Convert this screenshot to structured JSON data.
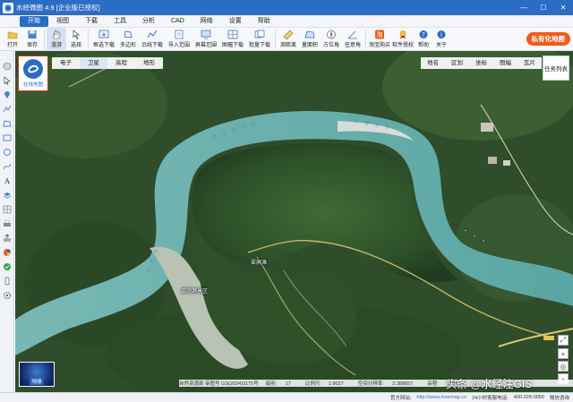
{
  "titlebar": {
    "title": "水经微图 4.9 [企业版已授权]",
    "controls": [
      "—",
      "☐",
      "✕"
    ]
  },
  "menu": [
    {
      "label": "开始",
      "active": true
    },
    {
      "label": "视图"
    },
    {
      "label": "下载"
    },
    {
      "label": "工具"
    },
    {
      "label": "分析"
    },
    {
      "label": "CAD"
    },
    {
      "label": "网络"
    },
    {
      "label": "设置"
    },
    {
      "label": "帮助"
    }
  ],
  "toolbar": [
    {
      "label": "打开",
      "icon": "folder-icon"
    },
    {
      "label": "保存",
      "icon": "save-icon"
    },
    {
      "label": "漫游",
      "icon": "hand-icon",
      "selected": true
    },
    {
      "label": "选择",
      "icon": "cursor-icon"
    },
    {
      "label": "框选下载",
      "icon": "box-download-icon"
    },
    {
      "label": "多边形",
      "icon": "polygon-icon"
    },
    {
      "label": "沿线下载",
      "icon": "line-download-icon"
    },
    {
      "label": "导入范围",
      "icon": "import-icon"
    },
    {
      "label": "屏幕范围",
      "icon": "screen-icon"
    },
    {
      "label": "图幅下载",
      "icon": "sheet-icon"
    },
    {
      "label": "批量下载",
      "icon": "batch-icon"
    },
    {
      "label": "测距离",
      "icon": "ruler-icon"
    },
    {
      "label": "量面积",
      "icon": "area-icon"
    },
    {
      "label": "方位角",
      "icon": "compass-icon"
    },
    {
      "label": "任意角",
      "icon": "angle-icon"
    },
    {
      "label": "淘宝购买",
      "icon": "taobao-icon"
    },
    {
      "label": "软件授权",
      "icon": "license-icon"
    },
    {
      "label": "帮助",
      "icon": "help-icon"
    },
    {
      "label": "关于",
      "icon": "info-icon"
    }
  ],
  "private_map_button": "私有化地图",
  "logo_label": "在线地图",
  "layer_tabs": [
    {
      "label": "电子"
    },
    {
      "label": "卫星",
      "active": true
    },
    {
      "label": "高程"
    },
    {
      "label": "地形"
    }
  ],
  "right_tabs": [
    "地名",
    "区划",
    "坐标",
    "图幅",
    "瓦片"
  ],
  "task_list": "任务列表",
  "map_labels": {
    "scenic": "翠屏滩",
    "area": "莱茵港景区"
  },
  "globe_label": "地球",
  "coord_bar": {
    "source": "自然资源部 审图号 GS(2024)3175号",
    "level_label": "级别:",
    "level": "17",
    "scale_label": "比例尺:",
    "scale": "1:9027",
    "resolution_label": "空间分辨率:",
    "resolution": "2.388657",
    "elevation_label": "高程:",
    "elevation": "1184.32"
  },
  "status_bar": {
    "site_label": "官方网站:",
    "site": "http://www.rivermap.cn",
    "hotline_label": "24小时客服电话:",
    "hotline": "400-028-0050",
    "wechat": "微信咨询"
  },
  "watermark": "头条 @水经注GIS",
  "colors": {
    "title_blue": "#2b6cc4",
    "accent_orange": "#f05a1a",
    "river": "#5aa9a8",
    "forest": "#2f4d2a"
  }
}
